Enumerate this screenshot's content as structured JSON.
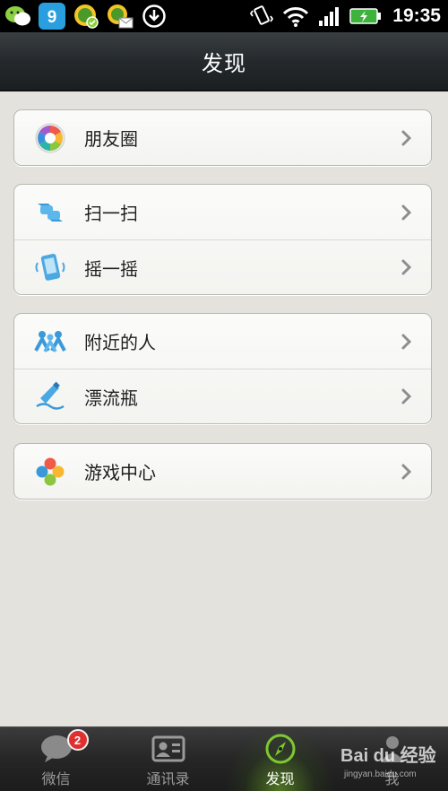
{
  "status_bar": {
    "time": "19:35",
    "notification_icons": [
      "wechat-icon",
      "app-store-icon",
      "game-helper-icon",
      "message-icon",
      "download-icon"
    ],
    "system_icons": [
      "vibrate-icon",
      "wifi-icon",
      "signal-icon",
      "battery-charging-icon"
    ]
  },
  "header": {
    "title": "发现"
  },
  "menu": {
    "groups": [
      {
        "items": [
          {
            "label": "朋友圈",
            "icon": "moments-icon"
          }
        ]
      },
      {
        "items": [
          {
            "label": "扫一扫",
            "icon": "scan-icon"
          },
          {
            "label": "摇一摇",
            "icon": "shake-icon"
          }
        ]
      },
      {
        "items": [
          {
            "label": "附近的人",
            "icon": "people-nearby-icon"
          },
          {
            "label": "漂流瓶",
            "icon": "drift-bottle-icon"
          }
        ]
      },
      {
        "items": [
          {
            "label": "游戏中心",
            "icon": "game-center-icon"
          }
        ]
      }
    ]
  },
  "tabs": [
    {
      "label": "微信",
      "icon": "chat-bubble-icon",
      "badge": "2",
      "active": false
    },
    {
      "label": "通讯录",
      "icon": "contacts-card-icon",
      "active": false
    },
    {
      "label": "发现",
      "icon": "compass-icon",
      "active": true
    },
    {
      "label": "我",
      "icon": "person-icon",
      "active": false
    }
  ],
  "watermark": {
    "brand": "Bai du 经验",
    "url": "jingyan.baidu.com"
  },
  "colors": {
    "background": "#e3e2dd",
    "header": "#24292c",
    "badge": "#e02f2f",
    "active_tab_glow": "#78be28"
  }
}
